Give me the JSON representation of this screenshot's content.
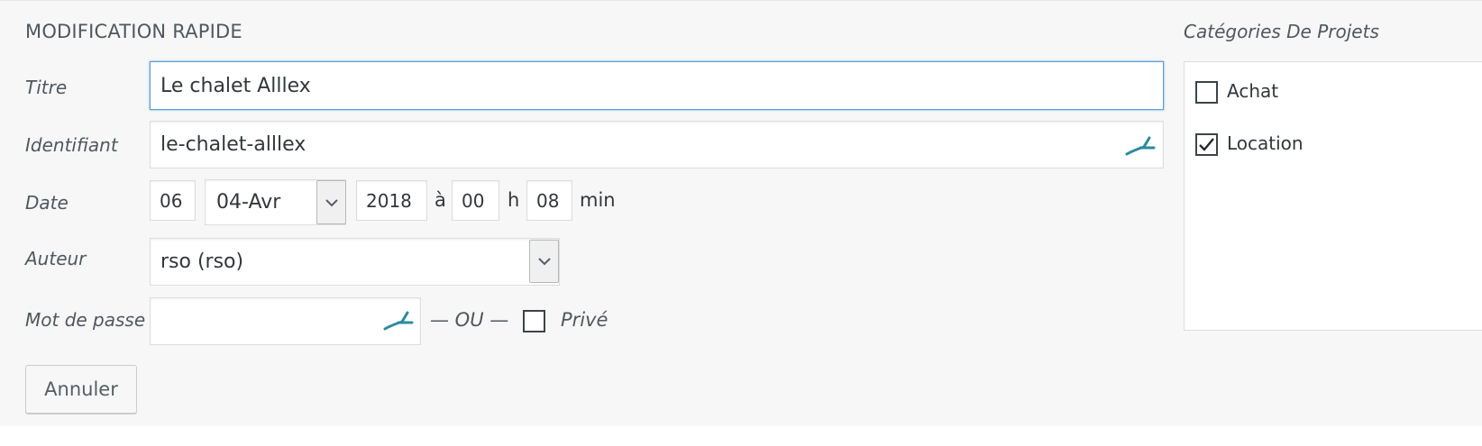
{
  "section_title": "MODIFICATION RAPIDE",
  "fields": {
    "title": {
      "label": "Titre",
      "value": "Le chalet Alllex"
    },
    "slug": {
      "label": "Identifiant",
      "value": "le-chalet-alllex"
    },
    "date": {
      "label": "Date",
      "day": "06",
      "month": "04-Avr",
      "year": "2018",
      "at": "à",
      "hour": "00",
      "h": "h",
      "minute": "08",
      "min": "min"
    },
    "author": {
      "label": "Auteur",
      "value": "rso (rso)"
    },
    "password": {
      "label": "Mot de passe",
      "value": "",
      "or_text": "— OU —",
      "private_label": "Privé",
      "private_checked": false
    }
  },
  "categories": {
    "title": "Catégories De Projets",
    "items": [
      {
        "label": "Achat",
        "checked": false
      },
      {
        "label": "Location",
        "checked": true
      }
    ]
  },
  "buttons": {
    "cancel": "Annuler"
  },
  "colors": {
    "accent": "#2b8aa0",
    "focus": "#5b9dd9"
  },
  "icons": {
    "key": "password-manager-icon",
    "chevron": "chevron-down-icon",
    "check": "checkmark-icon"
  }
}
